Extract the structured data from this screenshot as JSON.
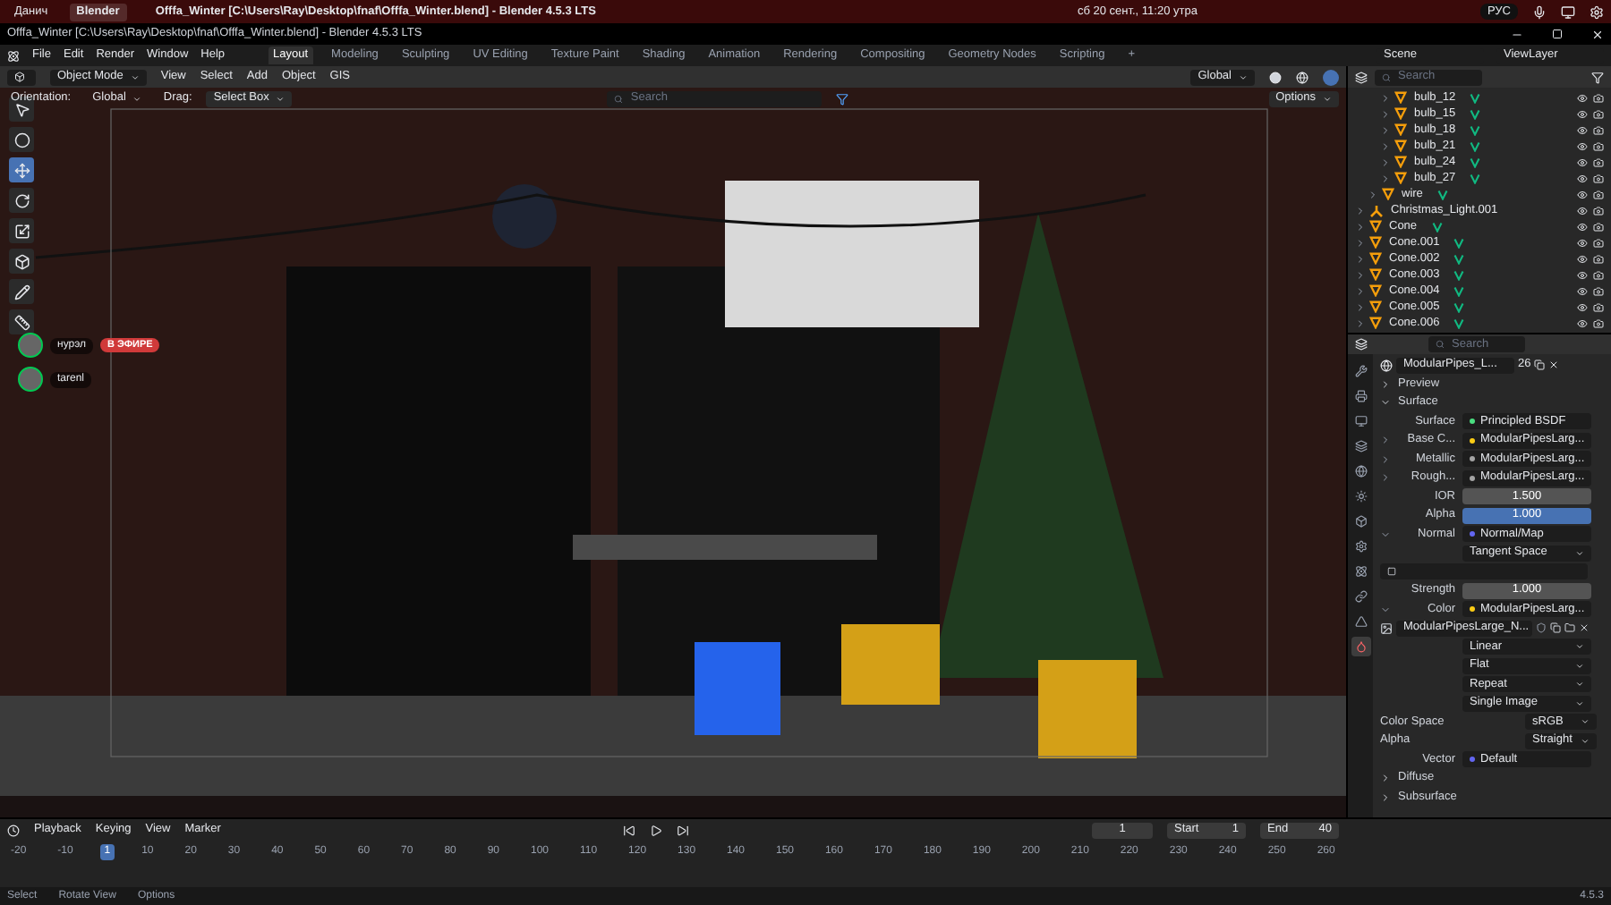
{
  "taskbar": {
    "apps": [
      {
        "label": "Данич",
        "selected": false
      },
      {
        "label": "Blender",
        "selected": true
      }
    ],
    "title": "Offfa_Winter [C:\\Users\\Ray\\Desktop\\fnaf\\Offfa_Winter.blend] - Blender 4.5.3 LTS",
    "clock": "сб 20 сент., 11:20 утра",
    "language": "РУС"
  },
  "window": {
    "title": "Offfa_Winter [C:\\Users\\Ray\\Desktop\\fnaf\\Offfa_Winter.blend] - Blender 4.5.3 LTS"
  },
  "menu": [
    "File",
    "Edit",
    "Render",
    "Window",
    "Help"
  ],
  "workspaces": [
    {
      "label": "Layout",
      "selected": true
    },
    {
      "label": "Modeling",
      "selected": false
    },
    {
      "label": "Sculpting",
      "selected": false
    },
    {
      "label": "UV Editing",
      "selected": false
    },
    {
      "label": "Texture Paint",
      "selected": false
    },
    {
      "label": "Shading",
      "selected": false
    },
    {
      "label": "Animation",
      "selected": false
    },
    {
      "label": "Rendering",
      "selected": false
    },
    {
      "label": "Compositing",
      "selected": false
    },
    {
      "label": "Geometry Nodes",
      "selected": false
    },
    {
      "label": "Scripting",
      "selected": false
    },
    {
      "label": "+",
      "selected": false
    }
  ],
  "scene": "Scene",
  "view_layer": "ViewLayer",
  "viewport_header": {
    "mode": "Object Mode",
    "menus": [
      "View",
      "Select",
      "Add",
      "Object",
      "GIS"
    ],
    "transform": "Global"
  },
  "tool_settings": {
    "orientation_label": "Orientation:",
    "orientation": "Global",
    "drag_label": "Drag:",
    "drag": "Select Box",
    "search_placeholder": "Search",
    "options": "Options"
  },
  "tools": [
    {
      "selected": false
    },
    {
      "selected": false
    },
    {
      "selected": true
    },
    {
      "selected": false
    },
    {
      "selected": false
    },
    {
      "selected": false
    },
    {
      "selected": false
    },
    {
      "selected": false
    }
  ],
  "voice_overlay": [
    {
      "name": "нурэл",
      "badge": "В ЭФИРЕ"
    },
    {
      "name": "tarenl"
    }
  ],
  "outliner": {
    "search_placeholder": "Search",
    "rows": [
      {
        "children": [
          {
            "children": [
              {
                "name": "bulb_12",
                "kind": "mesh"
              },
              {
                "name": "bulb_15",
                "kind": "mesh"
              },
              {
                "name": "bulb_18",
                "kind": "mesh"
              },
              {
                "name": "bulb_21",
                "kind": "mesh"
              },
              {
                "name": "bulb_24",
                "kind": "mesh"
              },
              {
                "name": "bulb_27",
                "kind": "mesh"
              }
            ]
          },
          {
            "name": "wire",
            "kind": "mesh"
          }
        ]
      },
      {
        "name": "Christmas_Light.001",
        "kind": "empty"
      },
      {
        "name": "Cone",
        "kind": "mesh"
      },
      {
        "name": "Cone.001",
        "kind": "mesh"
      },
      {
        "name": "Cone.002",
        "kind": "mesh"
      },
      {
        "name": "Cone.003",
        "kind": "mesh"
      },
      {
        "name": "Cone.004",
        "kind": "mesh"
      },
      {
        "name": "Cone.005",
        "kind": "mesh"
      },
      {
        "name": "Cone.006",
        "kind": "mesh"
      }
    ]
  },
  "properties": {
    "search_placeholder": "Search",
    "material": "ModularPipes_L...",
    "users": "26",
    "tabs": [
      {
        "selected": false
      },
      {
        "selected": false
      },
      {
        "selected": false
      },
      {
        "selected": false
      },
      {
        "selected": false
      },
      {
        "selected": false
      },
      {
        "selected": false
      },
      {
        "selected": false
      },
      {
        "selected": false
      },
      {
        "selected": false
      },
      {
        "selected": false
      },
      {
        "selected": true
      }
    ],
    "panels_top": [
      {
        "label": "Preview",
        "expanded": false
      },
      {
        "label": "Surface",
        "expanded": true
      }
    ],
    "rows": [
      {
        "kind": "socket",
        "label": "Surface",
        "value": "Principled BSDF",
        "color": "#4ade80"
      },
      {
        "kind": "socket",
        "label": "Base C...",
        "value": "ModularPipesLarg...",
        "color": "#facc15",
        "expanded": false
      },
      {
        "kind": "socket",
        "label": "Metallic",
        "value": "ModularPipesLarg...",
        "color": "#a3a3a3",
        "expanded": false
      },
      {
        "kind": "socket",
        "label": "Rough...",
        "value": "ModularPipesLarg...",
        "color": "#a3a3a3",
        "expanded": false
      },
      {
        "kind": "number",
        "label": "IOR",
        "value": "1.500",
        "selected": false
      },
      {
        "kind": "number",
        "label": "Alpha",
        "value": "1.000",
        "selected": true
      },
      {
        "kind": "socket",
        "label": "Normal",
        "value": "Normal/Map",
        "color": "#6366f1",
        "expanded": true
      },
      {
        "kind": "dropdown",
        "value": "Tangent Space"
      },
      {
        "kind": "uvmap"
      },
      {
        "kind": "number",
        "label": "Strength",
        "value": "1.000",
        "selected": false
      },
      {
        "kind": "socket",
        "label": "Color",
        "value": "ModularPipesLarg...",
        "color": "#facc15",
        "expanded": true
      },
      {
        "kind": "image",
        "value": "ModularPipesLarge_N..."
      },
      {
        "kind": "dropdown",
        "value": "Linear"
      },
      {
        "kind": "dropdown",
        "value": "Flat"
      },
      {
        "kind": "dropdown",
        "value": "Repeat"
      },
      {
        "kind": "dropdown",
        "value": "Single Image"
      },
      {
        "kind": "setting",
        "label": "Color Space",
        "value": "sRGB"
      },
      {
        "kind": "setting",
        "label": "Alpha",
        "value": "Straight"
      },
      {
        "kind": "socket",
        "label": "Vector",
        "value": "Default",
        "color": "#6366f1"
      }
    ],
    "panels_bottom": [
      {
        "label": "Diffuse",
        "expanded": false
      },
      {
        "label": "Subsurface",
        "expanded": false
      }
    ]
  },
  "timeline": {
    "menus": [
      "Playback",
      "Keying",
      "View",
      "Marker"
    ],
    "frame": "1",
    "start_label": "Start",
    "start": "1",
    "end_label": "End",
    "end": "40",
    "ticks": [
      {
        "label": "-20",
        "selected": false
      },
      {
        "label": "-10",
        "selected": false
      },
      {
        "label": "1",
        "selected": true
      },
      {
        "label": "10",
        "selected": false
      },
      {
        "label": "20",
        "selected": false
      },
      {
        "label": "30",
        "selected": false
      },
      {
        "label": "40",
        "selected": false
      },
      {
        "label": "50",
        "selected": false
      },
      {
        "label": "60",
        "selected": false
      },
      {
        "label": "70",
        "selected": false
      },
      {
        "label": "80",
        "selected": false
      },
      {
        "label": "90",
        "selected": false
      },
      {
        "label": "100",
        "selected": false
      },
      {
        "label": "110",
        "selected": false
      },
      {
        "label": "120",
        "selected": false
      },
      {
        "label": "130",
        "selected": false
      },
      {
        "label": "140",
        "selected": false
      },
      {
        "label": "150",
        "selected": false
      },
      {
        "label": "160",
        "selected": false
      },
      {
        "label": "170",
        "selected": false
      },
      {
        "label": "180",
        "selected": false
      },
      {
        "label": "190",
        "selected": false
      },
      {
        "label": "200",
        "selected": false
      },
      {
        "label": "210",
        "selected": false
      },
      {
        "label": "220",
        "selected": false
      },
      {
        "label": "230",
        "selected": false
      },
      {
        "label": "240",
        "selected": false
      },
      {
        "label": "250",
        "selected": false
      },
      {
        "label": "260",
        "selected": false
      }
    ]
  },
  "status_bar": {
    "hints": [
      "Select",
      "Rotate View",
      "Options"
    ],
    "version": "4.5.3"
  }
}
